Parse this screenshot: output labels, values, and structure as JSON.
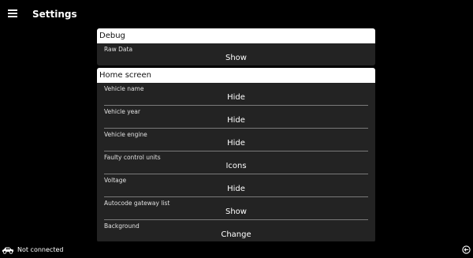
{
  "header": {
    "title": "Settings"
  },
  "sections": [
    {
      "title": "Debug",
      "items": [
        {
          "label": "Raw Data",
          "value": "Show"
        }
      ]
    },
    {
      "title": "Home screen",
      "items": [
        {
          "label": "Vehicle name",
          "value": "Hide"
        },
        {
          "label": "Vehicle year",
          "value": "Hide"
        },
        {
          "label": "Vehicle engine",
          "value": "Hide"
        },
        {
          "label": "Faulty control units",
          "value": "Icons"
        },
        {
          "label": "Voltage",
          "value": "Hide"
        },
        {
          "label": "Autocode gateway list",
          "value": "Show"
        },
        {
          "label": "Background",
          "value": "Change"
        }
      ]
    }
  ],
  "status": {
    "connection": "Not connected"
  },
  "icons": {
    "menu": "hamburger-menu-icon",
    "car": "car-icon",
    "exit": "exit-icon"
  }
}
